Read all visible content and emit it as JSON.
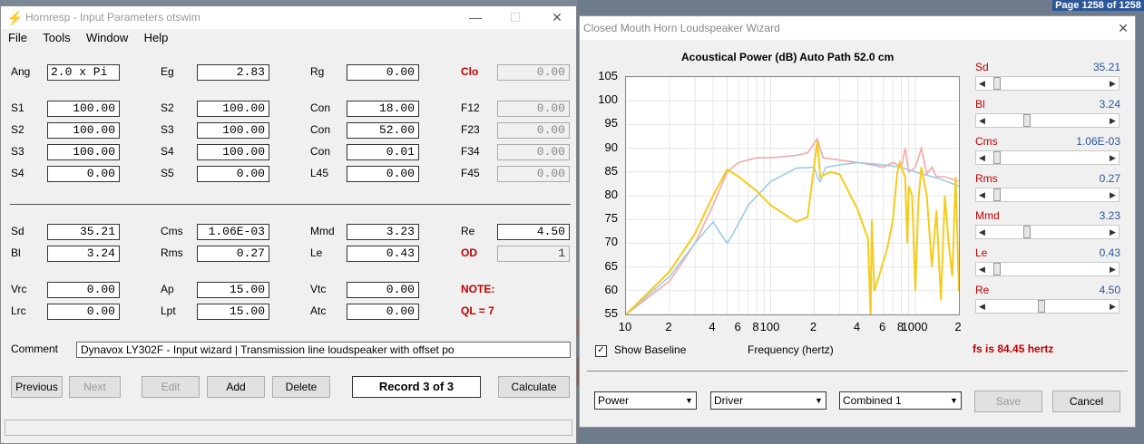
{
  "page_badge": "Page 1258 of 1258",
  "input_window": {
    "title": "Hornresp - Input Parameters   otswim",
    "menu": [
      "File",
      "Tools",
      "Window",
      "Help"
    ],
    "top_rows": [
      [
        {
          "l": "Ang",
          "v": "2.0 x Pi"
        },
        {
          "l": "Eg",
          "v": "2.83"
        },
        {
          "l": "Rg",
          "v": "0.00"
        },
        {
          "l": "Clo",
          "v": "0.00"
        }
      ],
      [
        {
          "l": "S1",
          "v": "100.00"
        },
        {
          "l": "S2",
          "v": "100.00"
        },
        {
          "l": "Con",
          "v": "18.00"
        },
        {
          "l": "F12",
          "v": "0.00"
        }
      ],
      [
        {
          "l": "S2",
          "v": "100.00"
        },
        {
          "l": "S3",
          "v": "100.00"
        },
        {
          "l": "Con",
          "v": "52.00"
        },
        {
          "l": "F23",
          "v": "0.00"
        }
      ],
      [
        {
          "l": "S3",
          "v": "100.00"
        },
        {
          "l": "S4",
          "v": "100.00"
        },
        {
          "l": "Con",
          "v": "0.01"
        },
        {
          "l": "F34",
          "v": "0.00"
        }
      ],
      [
        {
          "l": "S4",
          "v": "0.00"
        },
        {
          "l": "S5",
          "v": "0.00"
        },
        {
          "l": "L45",
          "v": "0.00"
        },
        {
          "l": "F45",
          "v": "0.00"
        }
      ]
    ],
    "driver_rows": [
      [
        {
          "l": "Sd",
          "v": "35.21"
        },
        {
          "l": "Cms",
          "v": "1.06E-03"
        },
        {
          "l": "Mmd",
          "v": "3.23"
        },
        {
          "l": "Re",
          "v": "4.50"
        }
      ],
      [
        {
          "l": "Bl",
          "v": "3.24"
        },
        {
          "l": "Rms",
          "v": "0.27"
        },
        {
          "l": "Le",
          "v": "0.43"
        },
        {
          "l": "OD",
          "v": "1"
        }
      ]
    ],
    "chamber_rows": [
      [
        {
          "l": "Vrc",
          "v": "0.00"
        },
        {
          "l": "Ap",
          "v": "15.00"
        },
        {
          "l": "Vtc",
          "v": "0.00"
        },
        {
          "l": "NOTE:",
          "v": ""
        }
      ],
      [
        {
          "l": "Lrc",
          "v": "0.00"
        },
        {
          "l": "Lpt",
          "v": "15.00"
        },
        {
          "l": "Atc",
          "v": "0.00"
        },
        {
          "l": "QL = 7",
          "v": ""
        }
      ]
    ],
    "comment_label": "Comment",
    "comment_value": "Dynavox LY302F - Input wizard | Transmission line loudspeaker with offset po",
    "buttons": {
      "previous": "Previous",
      "next": "Next",
      "edit": "Edit",
      "add": "Add",
      "delete": "Delete",
      "calculate": "Calculate"
    },
    "record": "Record 3 of 3"
  },
  "wizard_window": {
    "title": "Closed Mouth Horn Loudspeaker Wizard",
    "chart_heading": "Acoustical Power (dB)   Auto Path 52.0 cm",
    "show_baseline": "Show Baseline",
    "frequency_label": "Frequency (hertz)",
    "fs_note": "fs is 84.45 hertz",
    "sliders": [
      {
        "label": "Sd",
        "value": "35.21",
        "pos": 0.05
      },
      {
        "label": "Bl",
        "value": "3.24",
        "pos": 0.32
      },
      {
        "label": "Cms",
        "value": "1.06E-03",
        "pos": 0.05
      },
      {
        "label": "Rms",
        "value": "0.27",
        "pos": 0.05
      },
      {
        "label": "Mmd",
        "value": "3.23",
        "pos": 0.32
      },
      {
        "label": "Le",
        "value": "0.43",
        "pos": 0.05
      },
      {
        "label": "Re",
        "value": "4.50",
        "pos": 0.45
      }
    ],
    "combos": [
      "Power",
      "Driver",
      "Combined 1"
    ],
    "save": "Save",
    "cancel": "Cancel"
  },
  "colors": {
    "pink": "#f4a8a8",
    "blue": "#9ccbe8",
    "yellow": "#f5cc1a",
    "label_red": "#c00000",
    "value_blue": "#2b5797"
  },
  "chart_data": {
    "type": "line",
    "title": "Acoustical Power (dB)   Auto Path 52.0 cm",
    "xlabel": "Frequency (hertz)",
    "ylabel": "",
    "x_scale": "log",
    "xlim": [
      10,
      2000
    ],
    "ylim": [
      55,
      105
    ],
    "y_ticks": [
      105,
      100,
      95,
      90,
      85,
      80,
      75,
      70,
      65,
      60,
      55
    ],
    "x_tick_labels": [
      {
        "x": 10,
        "t": "10"
      },
      {
        "x": 20,
        "t": "2"
      },
      {
        "x": 40,
        "t": "4"
      },
      {
        "x": 60,
        "t": "6"
      },
      {
        "x": 80,
        "t": "8"
      },
      {
        "x": 100,
        "t": "100"
      },
      {
        "x": 200,
        "t": "2"
      },
      {
        "x": 400,
        "t": "4"
      },
      {
        "x": 600,
        "t": "6"
      },
      {
        "x": 800,
        "t": "8"
      },
      {
        "x": 1000,
        "t": "1000"
      },
      {
        "x": 2000,
        "t": "2"
      }
    ],
    "grid": true,
    "series": [
      {
        "color": "pink",
        "points": [
          [
            10,
            55
          ],
          [
            20,
            62
          ],
          [
            30,
            70
          ],
          [
            40,
            78
          ],
          [
            50,
            85
          ],
          [
            60,
            87
          ],
          [
            80,
            88
          ],
          [
            100,
            88
          ],
          [
            150,
            88.5
          ],
          [
            180,
            89
          ],
          [
            210,
            92
          ],
          [
            230,
            88
          ],
          [
            300,
            87.5
          ],
          [
            400,
            87
          ],
          [
            500,
            86.5
          ],
          [
            600,
            86
          ],
          [
            700,
            87
          ],
          [
            800,
            86
          ],
          [
            850,
            90
          ],
          [
            900,
            85
          ],
          [
            1000,
            86
          ],
          [
            1100,
            90
          ],
          [
            1200,
            84.5
          ],
          [
            1300,
            86
          ],
          [
            1400,
            84
          ],
          [
            1600,
            84
          ],
          [
            1800,
            83.5
          ],
          [
            2000,
            83
          ]
        ]
      },
      {
        "color": "blue",
        "points": [
          [
            10,
            55
          ],
          [
            20,
            63
          ],
          [
            30,
            70
          ],
          [
            40,
            74.5
          ],
          [
            45,
            72
          ],
          [
            50,
            70
          ],
          [
            55,
            72
          ],
          [
            70,
            78
          ],
          [
            100,
            83
          ],
          [
            150,
            85.8
          ],
          [
            200,
            86
          ],
          [
            210,
            84
          ],
          [
            220,
            83
          ],
          [
            240,
            86
          ],
          [
            300,
            86.5
          ],
          [
            400,
            87
          ],
          [
            600,
            86.5
          ],
          [
            800,
            86
          ],
          [
            1000,
            85
          ],
          [
            1500,
            83.5
          ],
          [
            2000,
            82
          ]
        ]
      },
      {
        "color": "yellow",
        "points": [
          [
            10,
            55
          ],
          [
            20,
            64
          ],
          [
            30,
            72
          ],
          [
            40,
            80
          ],
          [
            50,
            85.5
          ],
          [
            60,
            84
          ],
          [
            80,
            81
          ],
          [
            100,
            78
          ],
          [
            150,
            74.5
          ],
          [
            180,
            75.5
          ],
          [
            210,
            91.5
          ],
          [
            220,
            84
          ],
          [
            260,
            85
          ],
          [
            300,
            84.5
          ],
          [
            400,
            77
          ],
          [
            470,
            71
          ],
          [
            490,
            55
          ],
          [
            500,
            75
          ],
          [
            520,
            60
          ],
          [
            560,
            63
          ],
          [
            640,
            69
          ],
          [
            700,
            75
          ],
          [
            750,
            85
          ],
          [
            780,
            87
          ],
          [
            800,
            86
          ],
          [
            850,
            84
          ],
          [
            880,
            70
          ],
          [
            900,
            82
          ],
          [
            950,
            80
          ],
          [
            1000,
            60
          ],
          [
            1050,
            79
          ],
          [
            1100,
            86
          ],
          [
            1200,
            80
          ],
          [
            1300,
            65
          ],
          [
            1400,
            77
          ],
          [
            1500,
            58
          ],
          [
            1600,
            80
          ],
          [
            1700,
            70
          ],
          [
            1800,
            63
          ],
          [
            1900,
            84
          ],
          [
            2000,
            60
          ]
        ]
      }
    ]
  }
}
